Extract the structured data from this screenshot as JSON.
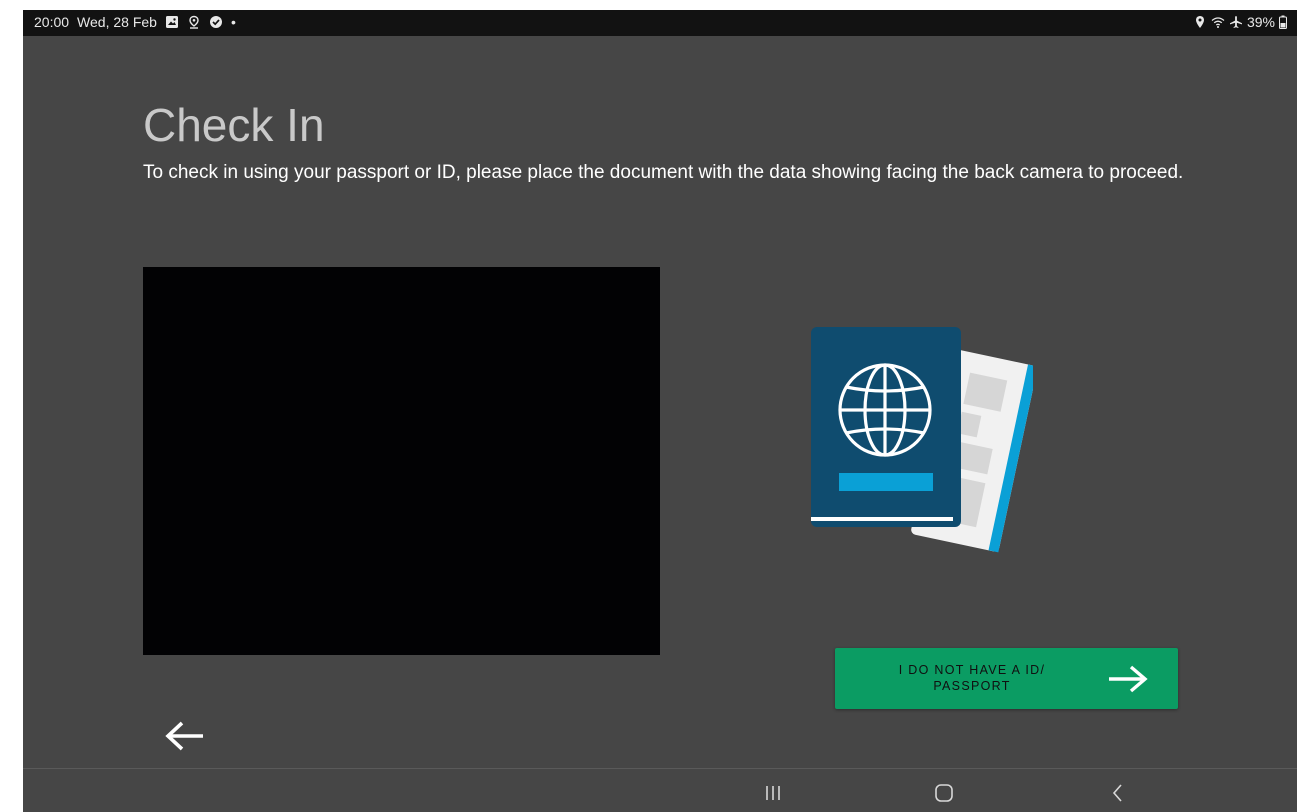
{
  "status_bar": {
    "time": "20:00",
    "date": "Wed, 28 Feb",
    "dot": "•",
    "battery": "39%",
    "icons_left": [
      "gallery-icon",
      "location-pin-icon",
      "check-circle-icon"
    ],
    "icons_right": [
      "location-icon",
      "wifi-icon",
      "airplane-icon",
      "battery-icon"
    ]
  },
  "page": {
    "title": "Check In",
    "instructions": "To check in using your passport or ID, please place the document with the data showing facing the back camera to proceed."
  },
  "actions": {
    "no_id_label": "I DO NOT HAVE A ID/ PASSPORT"
  },
  "nav_bar": {
    "items": [
      "recent-apps-icon",
      "home-icon",
      "back-nav-icon"
    ]
  },
  "colors": {
    "background": "#464646",
    "status_bar": "#121212",
    "camera_preview": "#020204",
    "button_green": "#0b9c63",
    "passport_navy": "#0f4c6f",
    "accent_blue": "#0aa0d6"
  }
}
